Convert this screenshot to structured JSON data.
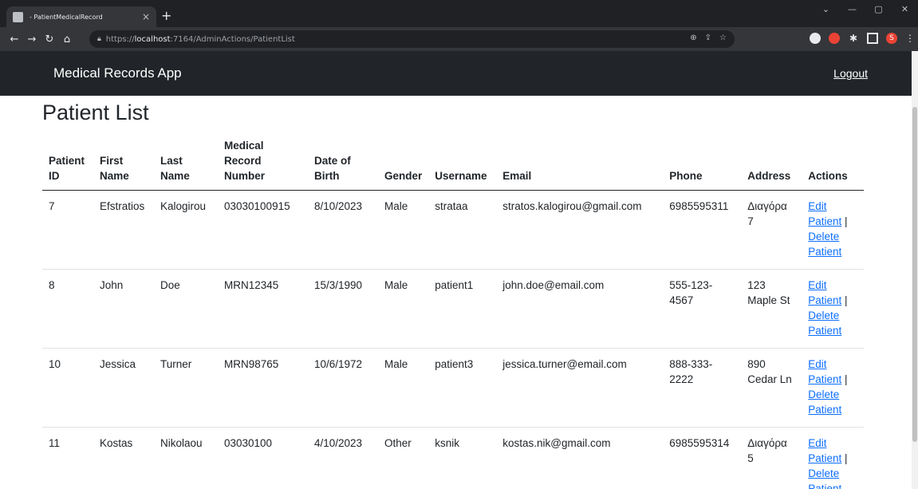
{
  "browser": {
    "tab_title": "- PatientMedicalRecord",
    "tab_close": "×",
    "new_tab": "+",
    "url_prefix": "https://",
    "url_host": "localhost",
    "url_path": ":7164/AdminActions/PatientList",
    "profile_initial": "S",
    "win_min": "—",
    "win_max": "▢",
    "win_close": "✕",
    "win_down": "⌄"
  },
  "app": {
    "brand": "Medical Records App",
    "logout": "Logout"
  },
  "page": {
    "title": "Patient List"
  },
  "table": {
    "headers": [
      "Patient ID",
      "First Name",
      "Last Name",
      "Medical Record Number",
      "Date of Birth",
      "Gender",
      "Username",
      "Email",
      "Phone",
      "Address",
      "Actions"
    ],
    "rows": [
      {
        "id": "7",
        "first": "Efstratios",
        "last": "Kalogirou",
        "mrn": "03030100915",
        "dob": "8/10/2023",
        "gender": "Male",
        "username": "strataa",
        "email": "stratos.kalogirou@gmail.com",
        "phone": "6985595311",
        "address": "Διαγόρα 7",
        "edit": "Edit Patient",
        "sep": " |",
        "delete": "Delete Patient"
      },
      {
        "id": "8",
        "first": "John",
        "last": "Doe",
        "mrn": "MRN12345",
        "dob": "15/3/1990",
        "gender": "Male",
        "username": "patient1",
        "email": "john.doe@email.com",
        "phone": "555-123-4567",
        "address": "123 Maple St",
        "edit": "Edit Patient",
        "sep": " |",
        "delete": "Delete Patient"
      },
      {
        "id": "10",
        "first": "Jessica",
        "last": "Turner",
        "mrn": "MRN98765",
        "dob": "10/6/1972",
        "gender": "Male",
        "username": "patient3",
        "email": "jessica.turner@email.com",
        "phone": "888-333-2222",
        "address": "890 Cedar Ln",
        "edit": "Edit Patient",
        "sep": " |",
        "delete": "Delete Patient"
      },
      {
        "id": "11",
        "first": "Kostas",
        "last": "Nikolaou",
        "mrn": "03030100",
        "dob": "4/10/2023",
        "gender": "Other",
        "username": "ksnik",
        "email": "kostas.nik@gmail.com",
        "phone": "6985595314",
        "address": "Διαγόρα 5",
        "edit": "Edit Patient",
        "sep": " |",
        "delete": "Delete Patient"
      }
    ]
  }
}
